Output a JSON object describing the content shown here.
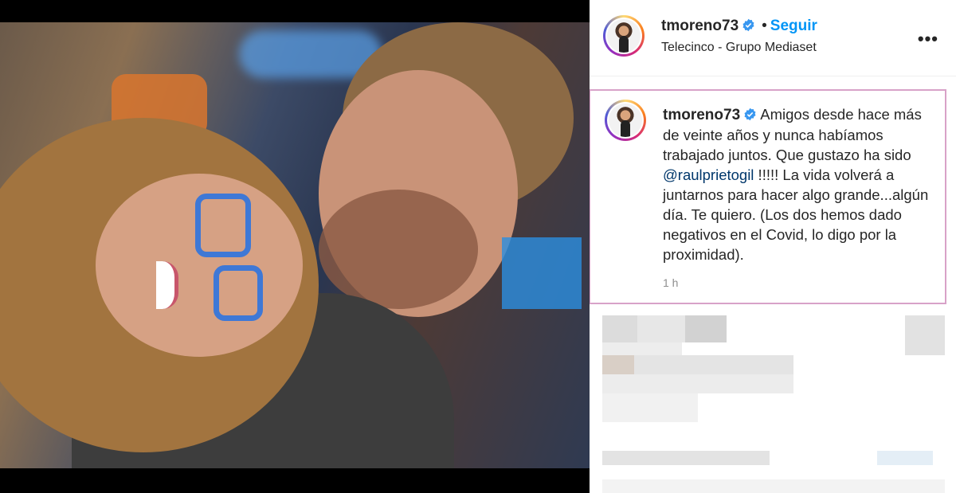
{
  "post": {
    "username": "tmoreno73",
    "follow_label": "Seguir",
    "separator": "•",
    "location": "Telecinco - Grupo Mediaset",
    "more_icon": "more-options-icon",
    "verified_icon": "verified-badge-icon"
  },
  "caption": {
    "username": "tmoreno73",
    "text_before": " Amigos desde hace más de veinte años y nunca habíamos trabajado juntos. Que gustazo ha sido ",
    "mention": "@raulprietogil",
    "text_after": " !!!!! La vida volverá a juntarnos para hacer algo grande...algún día. Te quiero. (Los dos hemos dado negativos en el Covid, lo digo por la proximidad).",
    "time": "1 h"
  },
  "colors": {
    "follow_blue": "#0095f6",
    "verified_blue": "#3897f0",
    "mention_blue": "#00376b",
    "caption_highlight_border": "#d8a2c8"
  }
}
